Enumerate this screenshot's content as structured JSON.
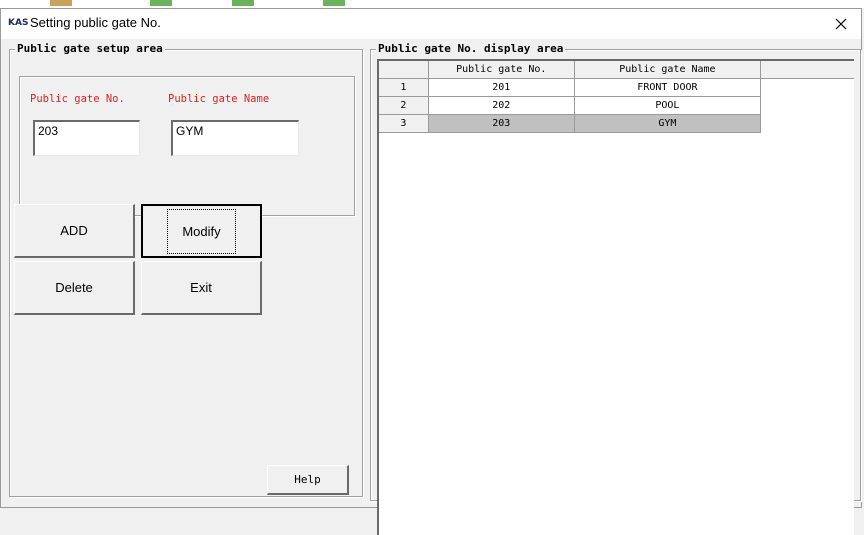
{
  "window": {
    "logo": "KAS",
    "title": "Setting public gate No.",
    "close_glyph": "✕"
  },
  "setup_area": {
    "legend": "Public gate setup area",
    "gate_no_label": "Public gate No.",
    "gate_name_label": "Public gate Name",
    "gate_no_value": "203",
    "gate_name_value": "GYM",
    "buttons": {
      "add": "ADD",
      "modify": "Modify",
      "delete": "Delete",
      "exit": "Exit",
      "help": "Help"
    }
  },
  "display_area": {
    "legend": "Public gate No. display area",
    "columns": [
      "Public gate No.",
      "Public gate Name"
    ],
    "rows": [
      {
        "index": "1",
        "gate_no": "201",
        "gate_name": "FRONT DOOR"
      },
      {
        "index": "2",
        "gate_no": "202",
        "gate_name": "POOL"
      },
      {
        "index": "3",
        "gate_no": "203",
        "gate_name": "GYM"
      }
    ],
    "selected_row": "3"
  },
  "colors": {
    "label_red": "#e52020",
    "selected_row_bg": "#c0c0c0",
    "window_bg": "#f0f0f0"
  },
  "icons": [
    "close-icon",
    "kas-logo"
  ]
}
